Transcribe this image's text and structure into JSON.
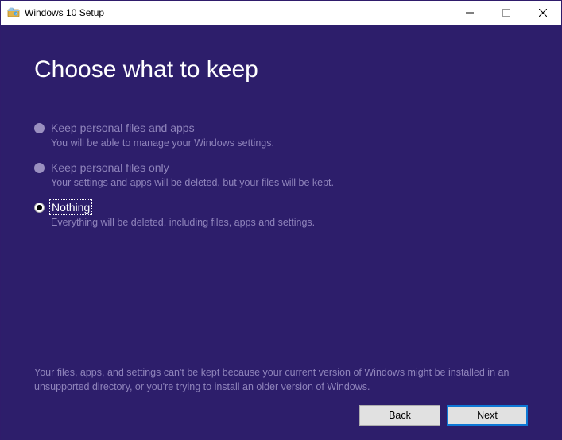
{
  "window": {
    "title": "Windows 10 Setup"
  },
  "heading": "Choose what to keep",
  "options": [
    {
      "label": "Keep personal files and apps",
      "desc": "You will be able to manage your Windows settings.",
      "selected": false,
      "enabled": false
    },
    {
      "label": "Keep personal files only",
      "desc": "Your settings and apps will be deleted, but your files will be kept.",
      "selected": false,
      "enabled": false
    },
    {
      "label": "Nothing",
      "desc": "Everything will be deleted, including files, apps and settings.",
      "selected": true,
      "enabled": true
    }
  ],
  "footer_note": "Your files, apps, and settings can't be kept because your current version of Windows might be installed in an unsupported directory, or you're trying to install an older version of Windows.",
  "buttons": {
    "back": "Back",
    "next": "Next"
  }
}
